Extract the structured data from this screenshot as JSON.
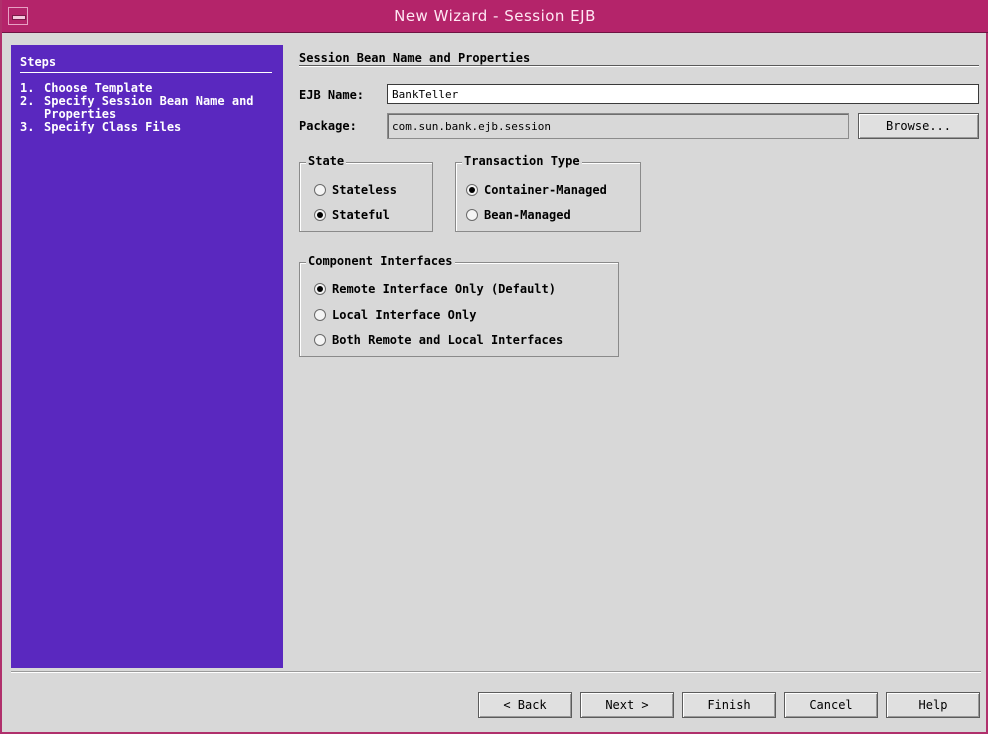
{
  "window": {
    "title": "New Wizard - Session EJB"
  },
  "steps": {
    "heading": "Steps",
    "items": [
      {
        "num": "1.",
        "label": "Choose Template"
      },
      {
        "num": "2.",
        "label": "Specify Session Bean Name and Properties"
      },
      {
        "num": "3.",
        "label": "Specify Class Files"
      }
    ]
  },
  "main": {
    "title": "Session Bean Name and Properties",
    "ejb_name": {
      "label": "EJB Name:",
      "value": "BankTeller"
    },
    "package": {
      "label": "Package:",
      "value": "com.sun.bank.ejb.session",
      "browse_label": "Browse..."
    },
    "state": {
      "title": "State",
      "options": [
        {
          "label": "Stateless",
          "selected": false
        },
        {
          "label": "Stateful",
          "selected": true
        }
      ]
    },
    "transaction": {
      "title": "Transaction Type",
      "options": [
        {
          "label": "Container-Managed",
          "selected": true
        },
        {
          "label": "Bean-Managed",
          "selected": false
        }
      ]
    },
    "interfaces": {
      "title": "Component Interfaces",
      "options": [
        {
          "label": "Remote Interface Only (Default)",
          "selected": true
        },
        {
          "label": "Local Interface Only",
          "selected": false
        },
        {
          "label": "Both Remote and Local Interfaces",
          "selected": false
        }
      ]
    }
  },
  "footer": {
    "back": "< Back",
    "next": "Next >",
    "finish": "Finish",
    "cancel": "Cancel",
    "help": "Help"
  },
  "colors": {
    "titlebar": "#b4246a",
    "sidebar": "#5a28bf",
    "window_bg": "#d8d8d8"
  }
}
